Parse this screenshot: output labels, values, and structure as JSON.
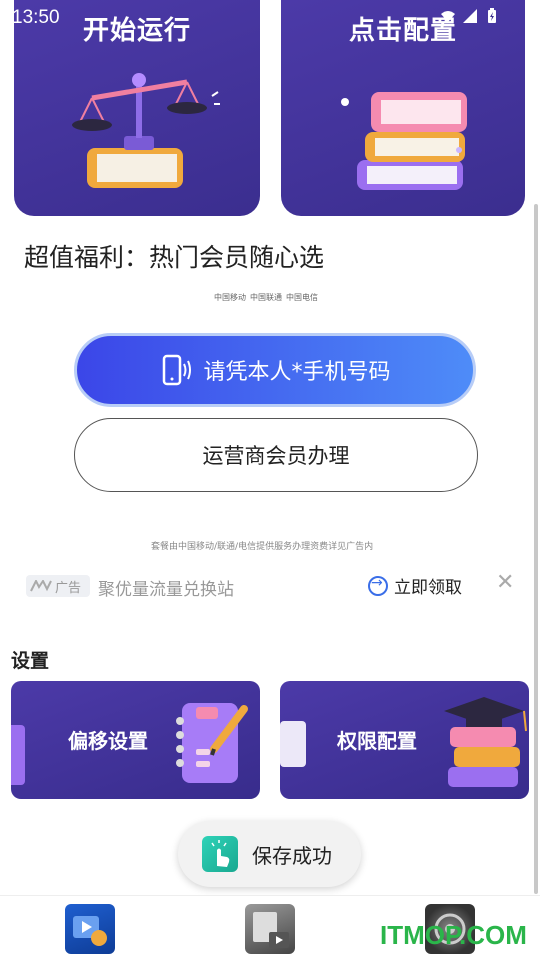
{
  "status_bar": {
    "time": "13:50"
  },
  "top_cards": [
    {
      "title": "开始运行",
      "icon": "scale-icon"
    },
    {
      "title": "点击配置",
      "icon": "books-icon"
    }
  ],
  "promo": {
    "heading": "超值福利：热门会员随心选"
  },
  "ad": {
    "carrier_logos": [
      "中国移动",
      "中国联通",
      "中国电信"
    ],
    "phone_button": "请凭本人*手机号码",
    "operator_button": "运营商会员办理",
    "note": "套餐由中国移动/联通/电信提供服务办理资费详见广告内"
  },
  "ad_strip": {
    "badge": "广告",
    "title": "聚优量流量兑换站",
    "claim": "立即领取",
    "close": "✕"
  },
  "settings": {
    "label": "设置",
    "cards": [
      {
        "title": "偏移设置",
        "icon": "notebook-icon"
      },
      {
        "title": "权限配置",
        "icon": "graduation-books-icon"
      }
    ]
  },
  "toast": {
    "text": "保存成功"
  },
  "bottom_nav": [
    {
      "icon": "video-player-icon"
    },
    {
      "icon": "gallery-icon"
    },
    {
      "icon": "dial-icon"
    }
  ],
  "watermark": "ITMOP.COM",
  "colors": {
    "card_purple": "#4c3aa8",
    "button_blue": "#3b46e8",
    "accent_blue": "#3a6ee8",
    "watermark_green": "#2ab54a"
  }
}
